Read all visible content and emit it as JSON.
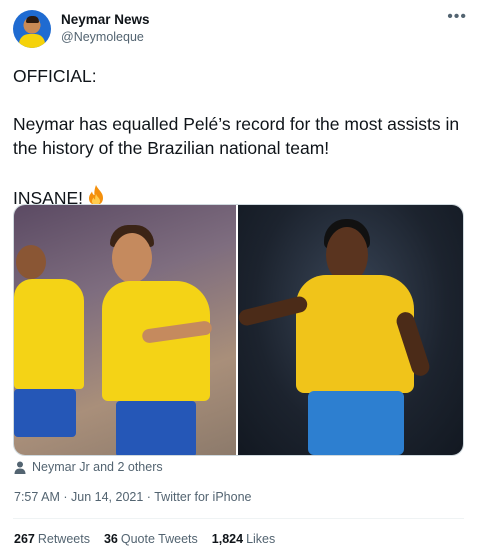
{
  "user": {
    "display_name": "Neymar News",
    "handle": "@Neymoleque"
  },
  "tweet": {
    "lines": [
      "OFFICIAL:",
      "Neymar has equalled Pelé’s record for the most assists in the history of the Brazilian national team!",
      "INSANE!"
    ],
    "emoji_icon": "fire-icon"
  },
  "media": {
    "left_photo": "photo-neymar-celebrating",
    "right_photo": "photo-pele-brazil-shirt"
  },
  "tagged": {
    "icon": "person-icon",
    "text": "Neymar Jr and 2 others"
  },
  "meta": {
    "time": "7:57 AM",
    "separator": "·",
    "date": "Jun 14, 2021",
    "source": "Twitter for iPhone"
  },
  "stats": {
    "retweets_count": "267",
    "retweets_label": "Retweets",
    "quotes_count": "36",
    "quotes_label": "Quote Tweets",
    "likes_count": "1,824",
    "likes_label": "Likes"
  },
  "colors": {
    "text_primary": "#0f1419",
    "text_secondary": "#536471",
    "divider": "#eff3f4"
  }
}
